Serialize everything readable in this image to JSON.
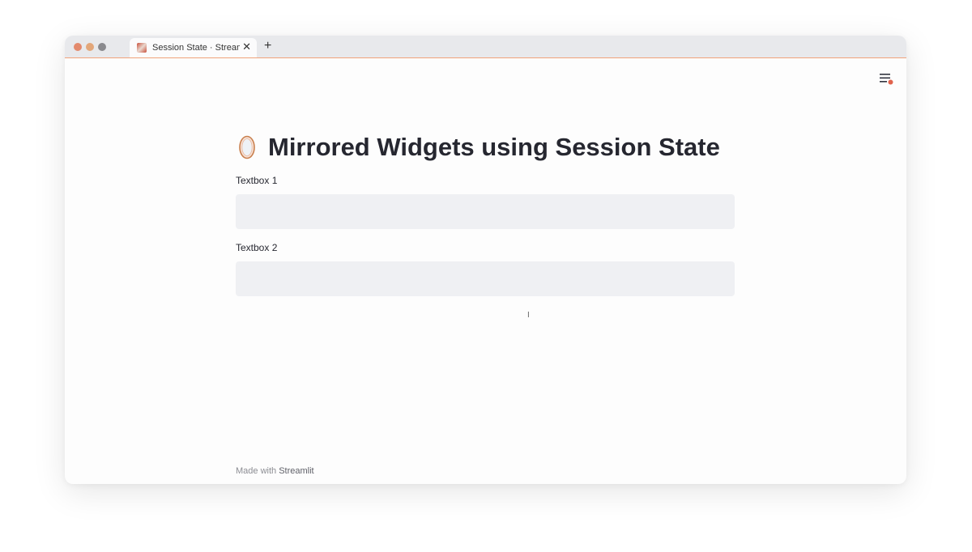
{
  "browser": {
    "tab_title": "Session State · Streamlit",
    "tab_close": "✕",
    "new_tab": "+"
  },
  "app": {
    "title": "Mirrored Widgets using Session State",
    "fields": [
      {
        "label": "Textbox 1",
        "value": "",
        "placeholder": ""
      },
      {
        "label": "Textbox 2",
        "value": "",
        "placeholder": ""
      }
    ],
    "footer_prefix": "Made with",
    "footer_brand": "Streamlit"
  },
  "colors": {
    "accent": "#f0a27a",
    "text": "#262730",
    "input_bg": "#eff0f3"
  },
  "icons": {
    "title_emoji": "mirror-icon",
    "menu": "hamburger-menu-icon"
  }
}
